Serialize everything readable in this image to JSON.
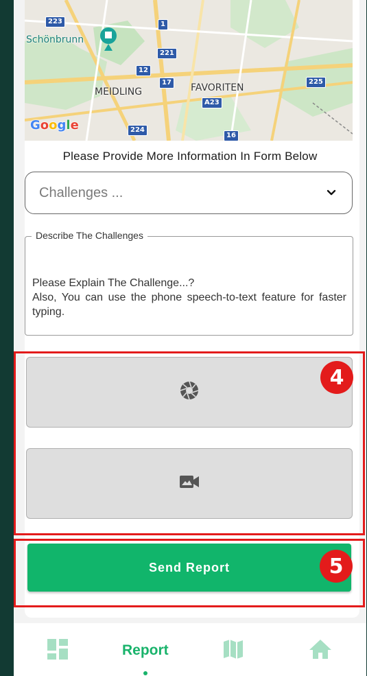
{
  "map": {
    "badges": [
      "223",
      "1",
      "221",
      "12",
      "17",
      "A23",
      "225",
      "224",
      "16"
    ],
    "labels": {
      "schonbrunn": "Schönbrunn",
      "meidling": "MEIDLING",
      "favoriten": "FAVORITEN"
    },
    "logo": "Google"
  },
  "form": {
    "intro": "Please Provide More Information In Form Below",
    "dropdown_placeholder": "Challenges ...",
    "description_legend": "Describe The Challenges",
    "description_placeholder_line1": "Please Explain The  Challenge...?",
    "description_placeholder_line2": "Also, You can use the phone speech-to-text feature for faster typing."
  },
  "annotations": {
    "media_badge": "4",
    "send_badge": "5"
  },
  "icons": {
    "photo": "camera-shutter-icon",
    "video": "video-camera-icon",
    "dashboard": "dashboard-icon",
    "map": "map-icon",
    "home": "home-icon",
    "dropdown": "chevron-down-icon"
  },
  "actions": {
    "send_label": "Send Report"
  },
  "nav": {
    "report_label": "Report"
  },
  "colors": {
    "primary": "#11b56b",
    "annotation_red": "#e31b1b",
    "background": "#123a33"
  }
}
